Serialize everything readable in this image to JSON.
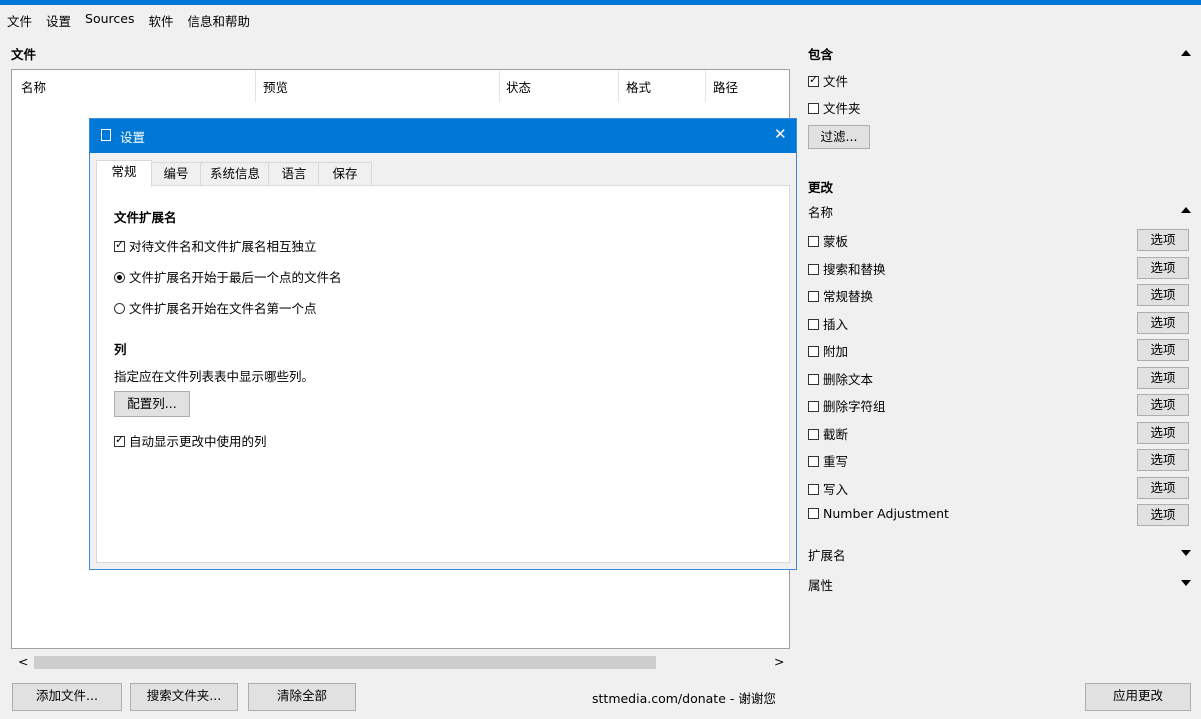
{
  "menu": [
    "文件",
    "设置",
    "Sources",
    "软件",
    "信息和帮助"
  ],
  "files_section": {
    "title": "文件",
    "columns": [
      "名称",
      "预览",
      "状态",
      "格式",
      "路径"
    ]
  },
  "scroll": {
    "left_arrow": "<",
    "right_arrow": ">"
  },
  "buttons": {
    "add_files": "添加文件...",
    "search_folder": "搜索文件夹...",
    "clear_all": "清除全部",
    "apply": "应用更改"
  },
  "donate_text": "sttmedia.com/donate - 谢谢您",
  "right_panel": {
    "include_title": "包含",
    "include_items": [
      {
        "label": "文件",
        "checked": true
      },
      {
        "label": "文件夹",
        "checked": false
      }
    ],
    "filter_button": "过滤...",
    "change_title": "更改",
    "name_subtitle": "名称",
    "option_label": "选项",
    "change_items": [
      "蒙板",
      "搜索和替换",
      "常规替换",
      "插入",
      "附加",
      "删除文本",
      "删除字符组",
      "截断",
      "重写",
      "写入",
      "Number Adjustment"
    ],
    "extension_title": "扩展名",
    "attributes_title": "属性"
  },
  "dialog": {
    "title": "设置",
    "close": "✕",
    "tabs": [
      "常规",
      "编号",
      "系统信息",
      "语言",
      "保存"
    ],
    "active_tab": 0,
    "ext_heading": "文件扩展名",
    "ext_independent": "对待文件名和文件扩展名相互独立",
    "ext_from_last_dot": "文件扩展名开始于最后一个点的文件名",
    "ext_from_first_dot": "文件扩展名开始在文件名第一个点",
    "col_heading": "列",
    "col_desc": "指定应在文件列表表中显示哪些列。",
    "config_button": "配置列...",
    "auto_show": "自动显示更改中使用的列"
  },
  "colors": {
    "accent": "#0078d7"
  }
}
